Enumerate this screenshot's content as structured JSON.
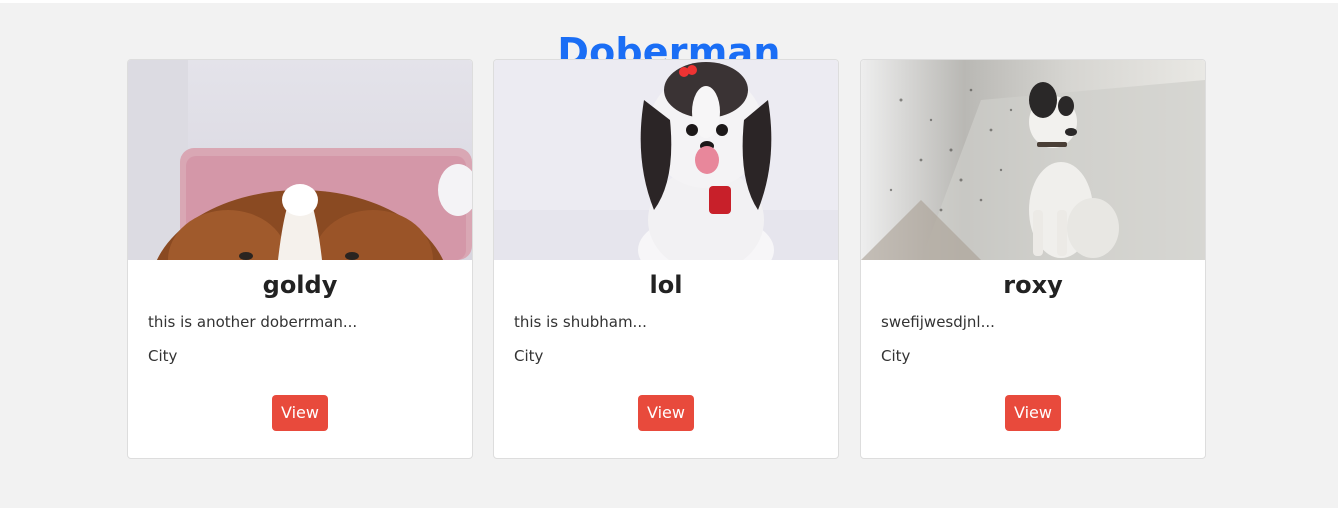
{
  "page": {
    "title": "Doberman"
  },
  "cards": [
    {
      "image": "dog-photo-cavalier-peeking",
      "name": "goldy",
      "description": "this is another doberrman...",
      "location": "City",
      "button_label": "View"
    },
    {
      "image": "dog-photo-shih-tzu-with-bow",
      "name": "lol",
      "description": "this is shubham...",
      "location": "City",
      "button_label": "View"
    },
    {
      "image": "dog-photo-white-terrier-sitting",
      "name": "roxy",
      "description": "swefijwesdjnl...",
      "location": "City",
      "button_label": "View"
    }
  ],
  "colors": {
    "background": "#f2f2f2",
    "title": "#1a6ef5",
    "button": "#e84a3c",
    "card": "#ffffff"
  }
}
